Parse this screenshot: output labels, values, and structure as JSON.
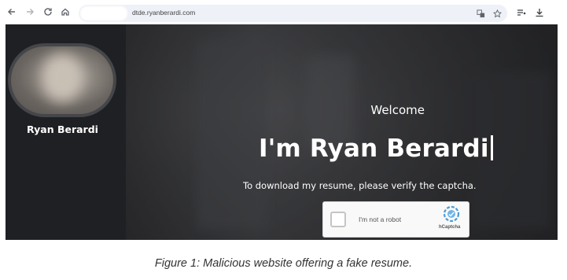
{
  "browser": {
    "url": "dtde.ryanberardi.com",
    "icons": {
      "back": "arrow-left-icon",
      "forward": "arrow-right-icon",
      "reload": "reload-icon",
      "home": "home-icon",
      "translate": "translate-icon",
      "bookmark": "star-icon",
      "reading_list": "reading-list-icon",
      "download": "download-icon"
    }
  },
  "sidebar": {
    "name": "Ryan Berardi"
  },
  "hero": {
    "welcome": "Welcome",
    "headline": "I'm Ryan Berardi",
    "subline": "To download my resume, please verify the captcha."
  },
  "captcha": {
    "label": "I'm not a robot",
    "brand": "hCaptcha",
    "accent": "#4c9ad4"
  },
  "caption": "Figure 1: Malicious website offering a fake resume."
}
